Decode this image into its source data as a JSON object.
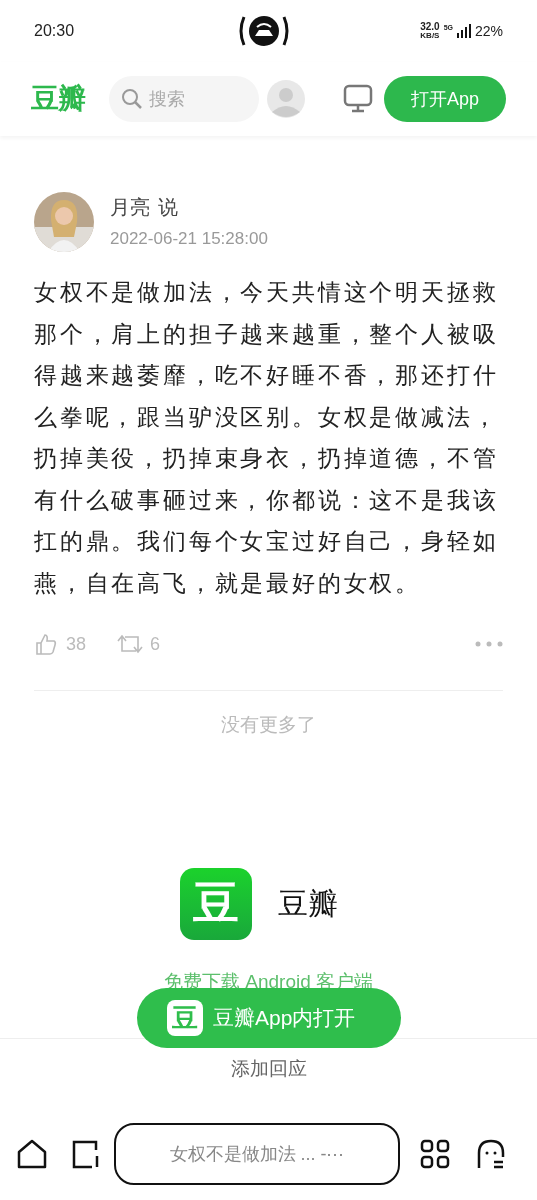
{
  "status_bar": {
    "time": "20:30",
    "speed": "32.0",
    "speed_unit": "KB/S",
    "network": "5G",
    "battery": "22%"
  },
  "header": {
    "logo": "豆瓣",
    "search": {
      "placeholder": "搜索"
    },
    "open_app": "打开App"
  },
  "post": {
    "author": "月亮",
    "verb": "说",
    "time": "2022-06-21 15:28:00",
    "body": "女权不是做加法，今天共情这个明天拯救那个，肩上的担子越来越重，整个人被吸得越来越萎靡，吃不好睡不香，那还打什么拳呢，跟当驴没区别。女权是做减法，扔掉美役，扔掉束身衣，扔掉道德，不管有什么破事砸过来，你都说：这不是我该扛的鼎。我们每个女宝过好自己，身轻如燕，自在高飞，就是最好的女权。",
    "likes": "38",
    "reshares": "6"
  },
  "end_note": "没有更多了",
  "promo": {
    "app_icon": "豆",
    "app_name": "豆瓣",
    "download": "免费下载 Android 客户端"
  },
  "float_button": {
    "icon": "豆",
    "label": "豆瓣App内打开"
  },
  "reply": "添加回应",
  "browser_bar": {
    "address": "女权不是做加法 ... -⋯"
  }
}
